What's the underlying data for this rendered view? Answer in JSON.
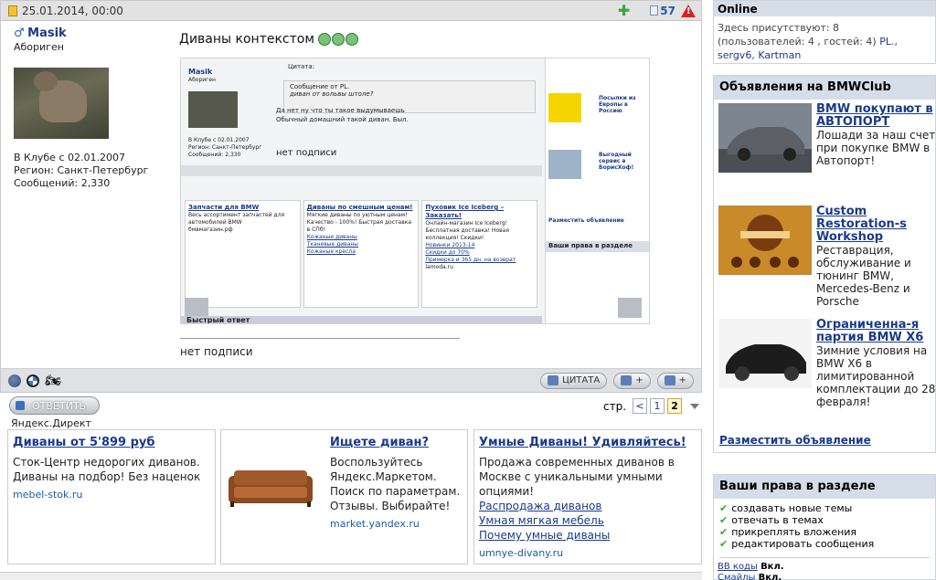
{
  "post": {
    "date": "25.01.2014, 00:00",
    "post_number": "57",
    "warn_mark": "!",
    "user": {
      "gender_mark": "♂",
      "name": "Masik",
      "rank": "Абориген",
      "joined": "В Клубе с 02.01.2007",
      "region": "Регион: Санкт-Петербург",
      "messages": "Сообщений: 2,330"
    },
    "title": "Диваны контекстом",
    "no_signature": "нет подписи",
    "buttons": {
      "quote": "ЦИТАТА"
    }
  },
  "embedded_screenshot": {
    "user": "Masik",
    "rank": "Абориген",
    "stats": [
      "В Клубе с 02.01.2007",
      "Регион: Санкт-Петербург",
      "Сообщений: 2,330"
    ],
    "quote_label": "Цитата:",
    "quote_from": "Сообщение от PL.",
    "quote_text": "диван от вольвы штоле?",
    "text_line1": "Да нет ну что ты такое выдумываешь",
    "text_line2": "Обычный домашний такой диван. Был.",
    "no_signature": "нет подписи",
    "ads": [
      {
        "title": "Запчасти для BMW",
        "text": "Весь ассортимент запчастей для автомобилей BMW",
        "domain": "бмвмагазин.рф"
      },
      {
        "title": "Диваны по смешным ценам!",
        "text": "Мягкие диваны по уютным ценам! Качество - 100%! Быстрая доставка в СПб!",
        "links": [
          "Кожаные диваны",
          "Тканевые диваны",
          "Кожаные кресла"
        ]
      },
      {
        "title": "Пуховик Ice Iceberg – Заказать!",
        "text": "Онлайн-магазин Ice Iceberg! Бесплатная доставка! Новая коллекция! Скидки!",
        "links": [
          "Новинки 2013-14",
          "Скидки до 70%",
          "Примерка и 365 дн. на возврат"
        ],
        "domain": "lamoda.ru"
      }
    ],
    "right_items": [
      "Посылки из Европы в Россию",
      "Выгодный сервис в БорисХоф!"
    ],
    "right_header": "Ваши права в разделе",
    "place_ad": "Разместить объявление",
    "bottom_title": "Быстрый ответ"
  },
  "reply_button": "ОТВЕТИТЬ",
  "pager": {
    "label": "стр.",
    "prev": "<",
    "pages": [
      "1",
      "2"
    ],
    "current": "2"
  },
  "yandex_direct": "Яндекс.Директ",
  "ads": {
    "ad1": {
      "title": "Диваны от 5'899 руб",
      "body": "Сток-Центр недорогих диванов. Диваны на подбор! Без наценок",
      "domain": "mebel-stok.ru"
    },
    "ad2": {
      "title": "Ищете диван?",
      "body": "Воспользуйтесь Яндекс.Маркетом. Поиск по параметрам. Отзывы. Выбирайте!",
      "domain": "market.yandex.ru"
    },
    "ad3": {
      "title": "Умные Диваны! Удивляйтесь!",
      "body": "Продажа современных диванов в Москве с уникальными умными опциями!",
      "links": [
        "Распродажа диванов",
        "Умная мягкая мебель",
        "Почему умные диваны"
      ],
      "domain": "umnye-divany.ru"
    }
  },
  "sidebar": {
    "online": {
      "title": "Online",
      "present": "Здесь присутствуют: 8",
      "details": "(пользователей: 4 , гостей: 4)",
      "users": [
        "PL.",
        "sergv6",
        "Kartman"
      ]
    },
    "announcements": {
      "title": "Объявления на BMWClub",
      "items": [
        {
          "title": "BMW покупают в АВТОПОРТ",
          "text": "Лошади за наш счет при покупке BMW в Автопорт!"
        },
        {
          "title": "Custom Restoration-s Workshop",
          "text": "Реставрация, обслуживание и тюнинг BMW, Mercedes-Benz и Porsche"
        },
        {
          "title": "Ограниченна-я партия BMW X6",
          "text": "Зимние условия на BMW X6 в лимитированной комплектации до 28 февраля!"
        }
      ],
      "place_ad": "Разместить объявление"
    },
    "rights": {
      "title": "Ваши права в разделе",
      "items": [
        "создавать новые темы",
        "отвечать в темах",
        "прикреплять вложения",
        "редактировать сообщения"
      ],
      "bb_label": "BB коды",
      "bb_value": "Вкл.",
      "smiles_label": "Смайлы",
      "smiles_value": "Вкл."
    }
  }
}
